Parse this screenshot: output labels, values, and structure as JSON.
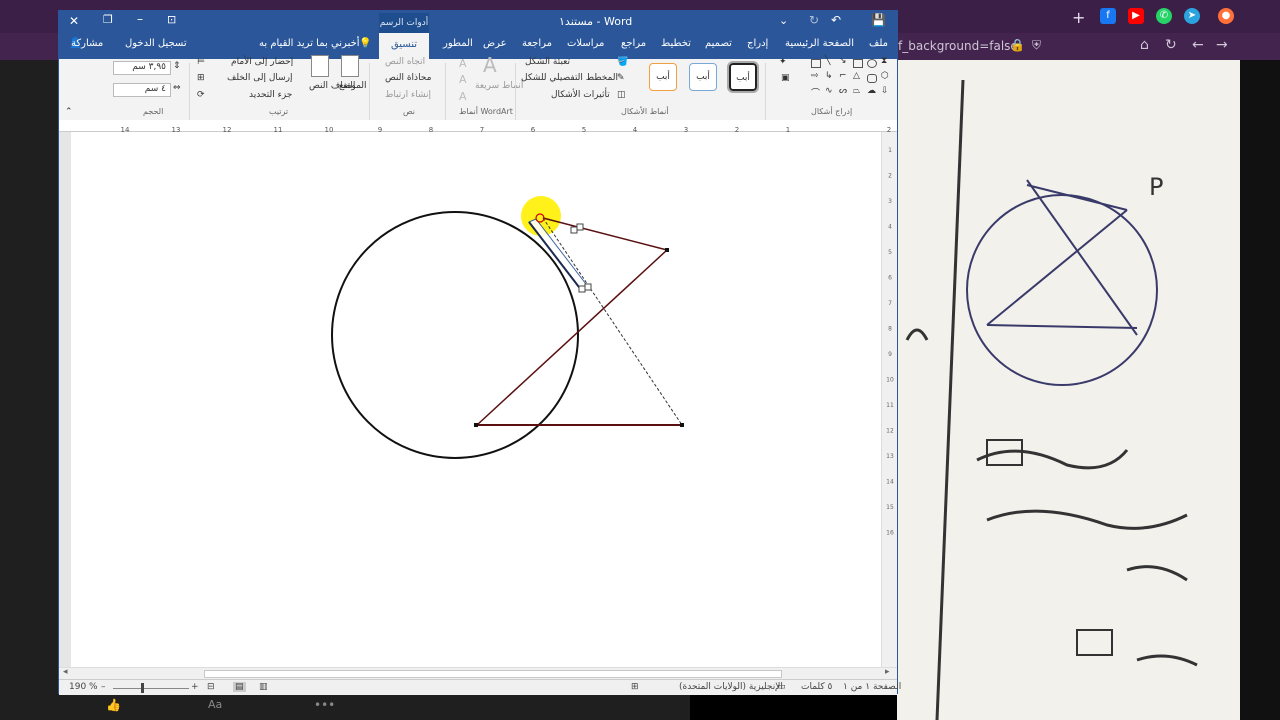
{
  "word": {
    "title": "مستند١ - Word",
    "tools_context": "أدوات الرسم",
    "active_tab": "تنسيق",
    "tabs": [
      "ملف",
      "الصفحة الرئيسية",
      "إدراج",
      "تصميم",
      "تخطيط",
      "مراجع",
      "مراسلات",
      "مراجعة",
      "عرض",
      "المطور"
    ],
    "tell_me": "أخبرني بما تريد القيام به",
    "sign_in": "تسجيل الدخول",
    "share": "مشاركة",
    "ribbon": {
      "insert_shapes_group": "إدراج أشكال",
      "shape_styles_group": "أنماط الأشكال",
      "style_sample": "أبب",
      "shape_fill": "تعبئة الشكل",
      "shape_outline": "المخطط التفصيلي للشكل",
      "shape_effects": "تأثيرات الأشكال",
      "wordart_group": "أنماط WordArt",
      "quick_styles": "أنماط سريعة",
      "text_direction": "اتجاه النص",
      "align_text": "محاذاة النص",
      "create_link": "إنشاء ارتباط",
      "text_group": "نص",
      "position": "الموضع",
      "wrap_text": "التفاف النص",
      "bring_forward": "إحضار إلى الأمام",
      "send_backward": "إرسال إلى الخلف",
      "selection_pane": "جزء التحديد",
      "arrange_group": "ترتيب",
      "height_value": "٣,٩٥ سم",
      "width_value": "٤ سم",
      "size_group": "الحجم"
    },
    "ruler_numbers": [
      "2",
      "1",
      "2",
      "3",
      "4",
      "5",
      "6",
      "7",
      "8",
      "9",
      "10",
      "11",
      "12",
      "13",
      "14"
    ],
    "vruler_numbers": [
      "1",
      "2",
      "3",
      "4",
      "5",
      "6",
      "7",
      "8",
      "9",
      "10",
      "11",
      "12",
      "13",
      "14",
      "15",
      "16"
    ],
    "status": {
      "page": "الصفحة ١ من ١",
      "words": "٥ كلمات",
      "language": "الإنجليزية (الولايات المتحدة)",
      "zoom": "190 %"
    }
  },
  "browser": {
    "address_fragment": "f_background=false"
  },
  "colors": {
    "word_blue": "#2b579a",
    "shape_line": "#5a1010",
    "highlight": "#ffef00"
  }
}
